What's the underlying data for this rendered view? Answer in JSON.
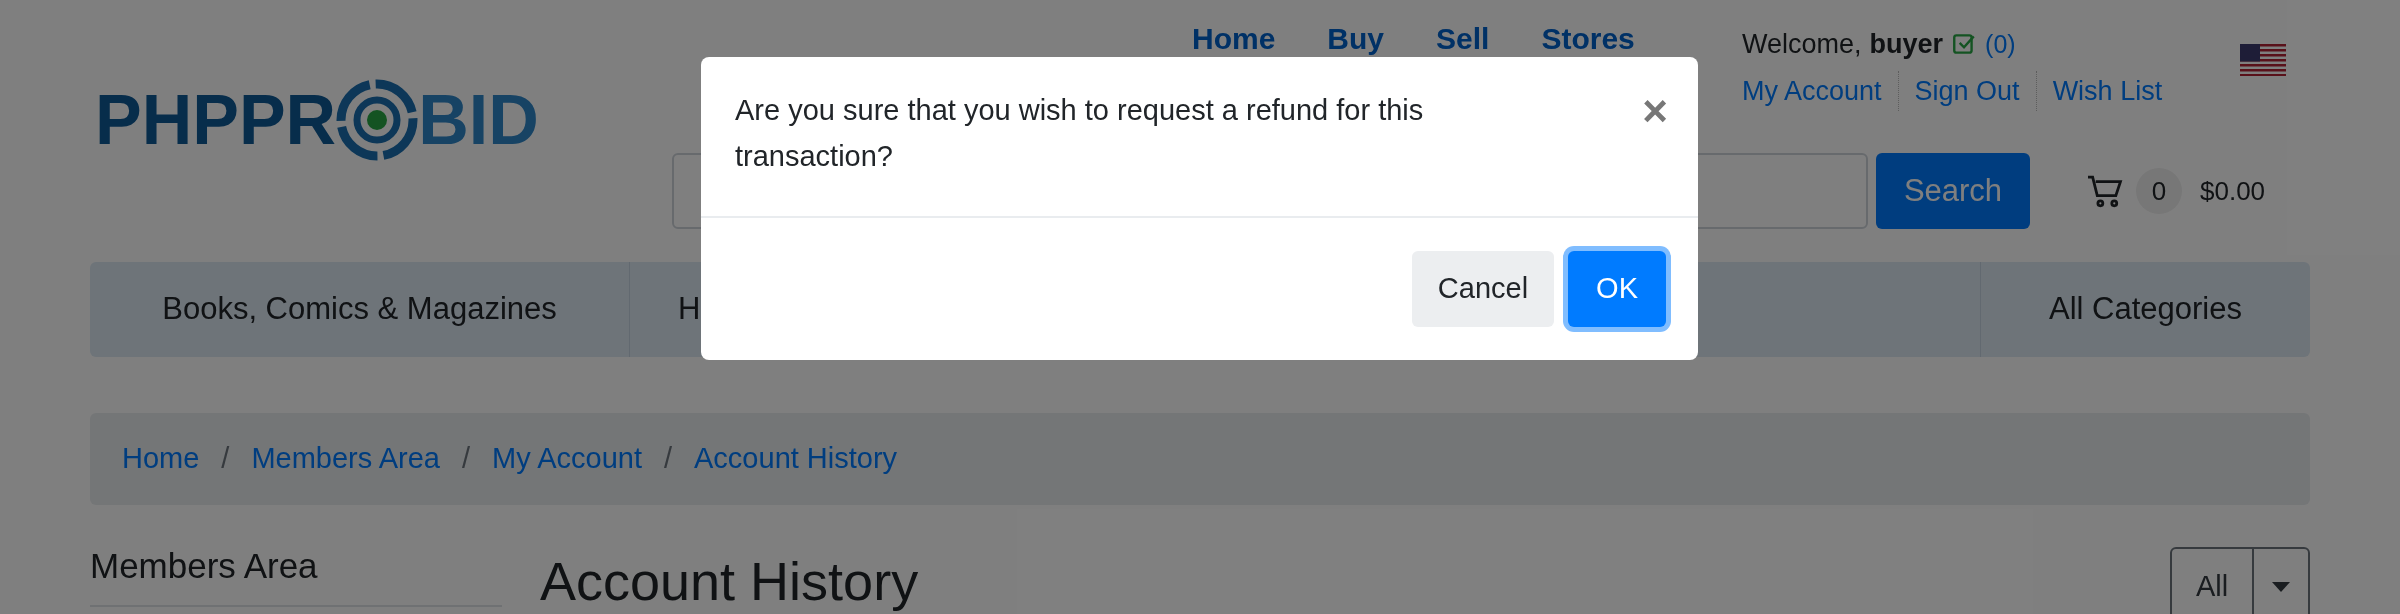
{
  "logo": {
    "text_before": "PHPPR",
    "text_after": "BID"
  },
  "nav": [
    "Home",
    "Buy",
    "Sell",
    "Stores"
  ],
  "user": {
    "welcome": "Welcome,",
    "username": "buyer",
    "count": "(0)",
    "links": [
      "My Account",
      "Sign Out",
      "Wish List"
    ]
  },
  "search": {
    "button": "Search"
  },
  "cart": {
    "count": "0",
    "total": "$0.00"
  },
  "categories": [
    "Books, Comics & Magazines",
    "H",
    "All Categories"
  ],
  "breadcrumb": {
    "items": [
      "Home",
      "Members Area",
      "My Account",
      "Account History"
    ],
    "separators": [
      "/",
      "/",
      "/"
    ]
  },
  "sidebar": {
    "title": "Members Area"
  },
  "page_title": "Account History",
  "filter": {
    "value": "All"
  },
  "dialog": {
    "message": "Are you sure that you wish to request a refund for this transaction?",
    "close": "×",
    "buttons": [
      {
        "label": "Cancel",
        "kind": "secondary",
        "focused": false
      },
      {
        "label": "OK",
        "kind": "primary",
        "focused": true
      }
    ]
  }
}
